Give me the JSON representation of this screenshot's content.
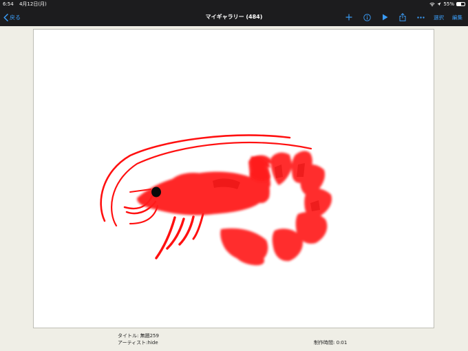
{
  "status": {
    "time": "6:54",
    "date": "4月12日(月)",
    "battery_text": "55%",
    "battery_level": 0.55
  },
  "nav": {
    "back_label": "戻る",
    "title": "マイギャラリー (484)",
    "select_label": "選択",
    "edit_label": "編集"
  },
  "artwork": {
    "title_line": "タイトル: 無題259",
    "artist_line": "アーティスト:hide",
    "time_line": "制作時間:   0:01"
  },
  "colors": {
    "accent": "#3a9bf5",
    "shrimp": "#ff1010",
    "bar": "#1c1c1e",
    "page": "#efeee6"
  }
}
